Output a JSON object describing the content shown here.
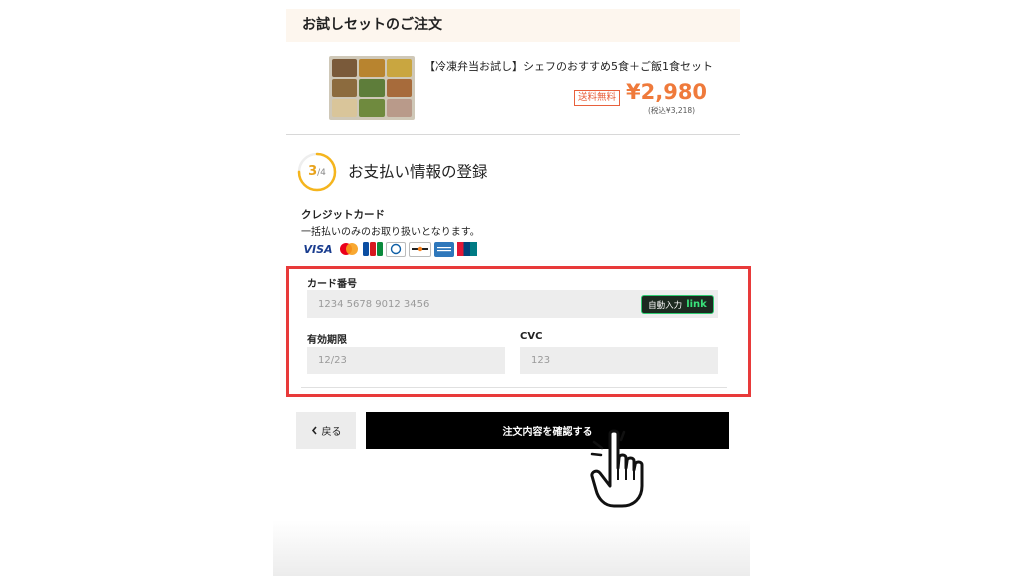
{
  "order": {
    "header": "お試しセットのご注文",
    "product_name": "【冷凍弁当お試し】シェフのおすすめ5食＋ご飯1食セット",
    "shipping_badge": "送料無料",
    "price": "¥2,980",
    "tax_note": "(税込¥3,218)"
  },
  "step": {
    "current": "3",
    "total": "/4",
    "progress": 0.75,
    "title": "お支払い情報の登録"
  },
  "payment": {
    "heading": "クレジットカード",
    "note": "一括払いのみのお取り扱いとなります。",
    "brands": [
      "VISA",
      "Mastercard",
      "JCB",
      "Diners Club",
      "DISCOVER",
      "American Express",
      "UnionPay"
    ]
  },
  "form": {
    "card_number_label": "カード番号",
    "card_number_placeholder": "1234 5678 9012 3456",
    "autofill_label": "自動入力",
    "autofill_link": "link",
    "expiry_label": "有効期限",
    "expiry_placeholder": "12/23",
    "cvc_label": "CVC",
    "cvc_placeholder": "123"
  },
  "actions": {
    "back_label": "戻る",
    "back_icon": "chevron-left-icon",
    "confirm_label": "注文内容を確認する"
  },
  "colors": {
    "accent_orange": "#ef7a3b",
    "step_ring": "#f5b51d",
    "highlight_red": "#e83a3a",
    "confirm_bg": "#000000",
    "link_green": "#39e37a"
  }
}
